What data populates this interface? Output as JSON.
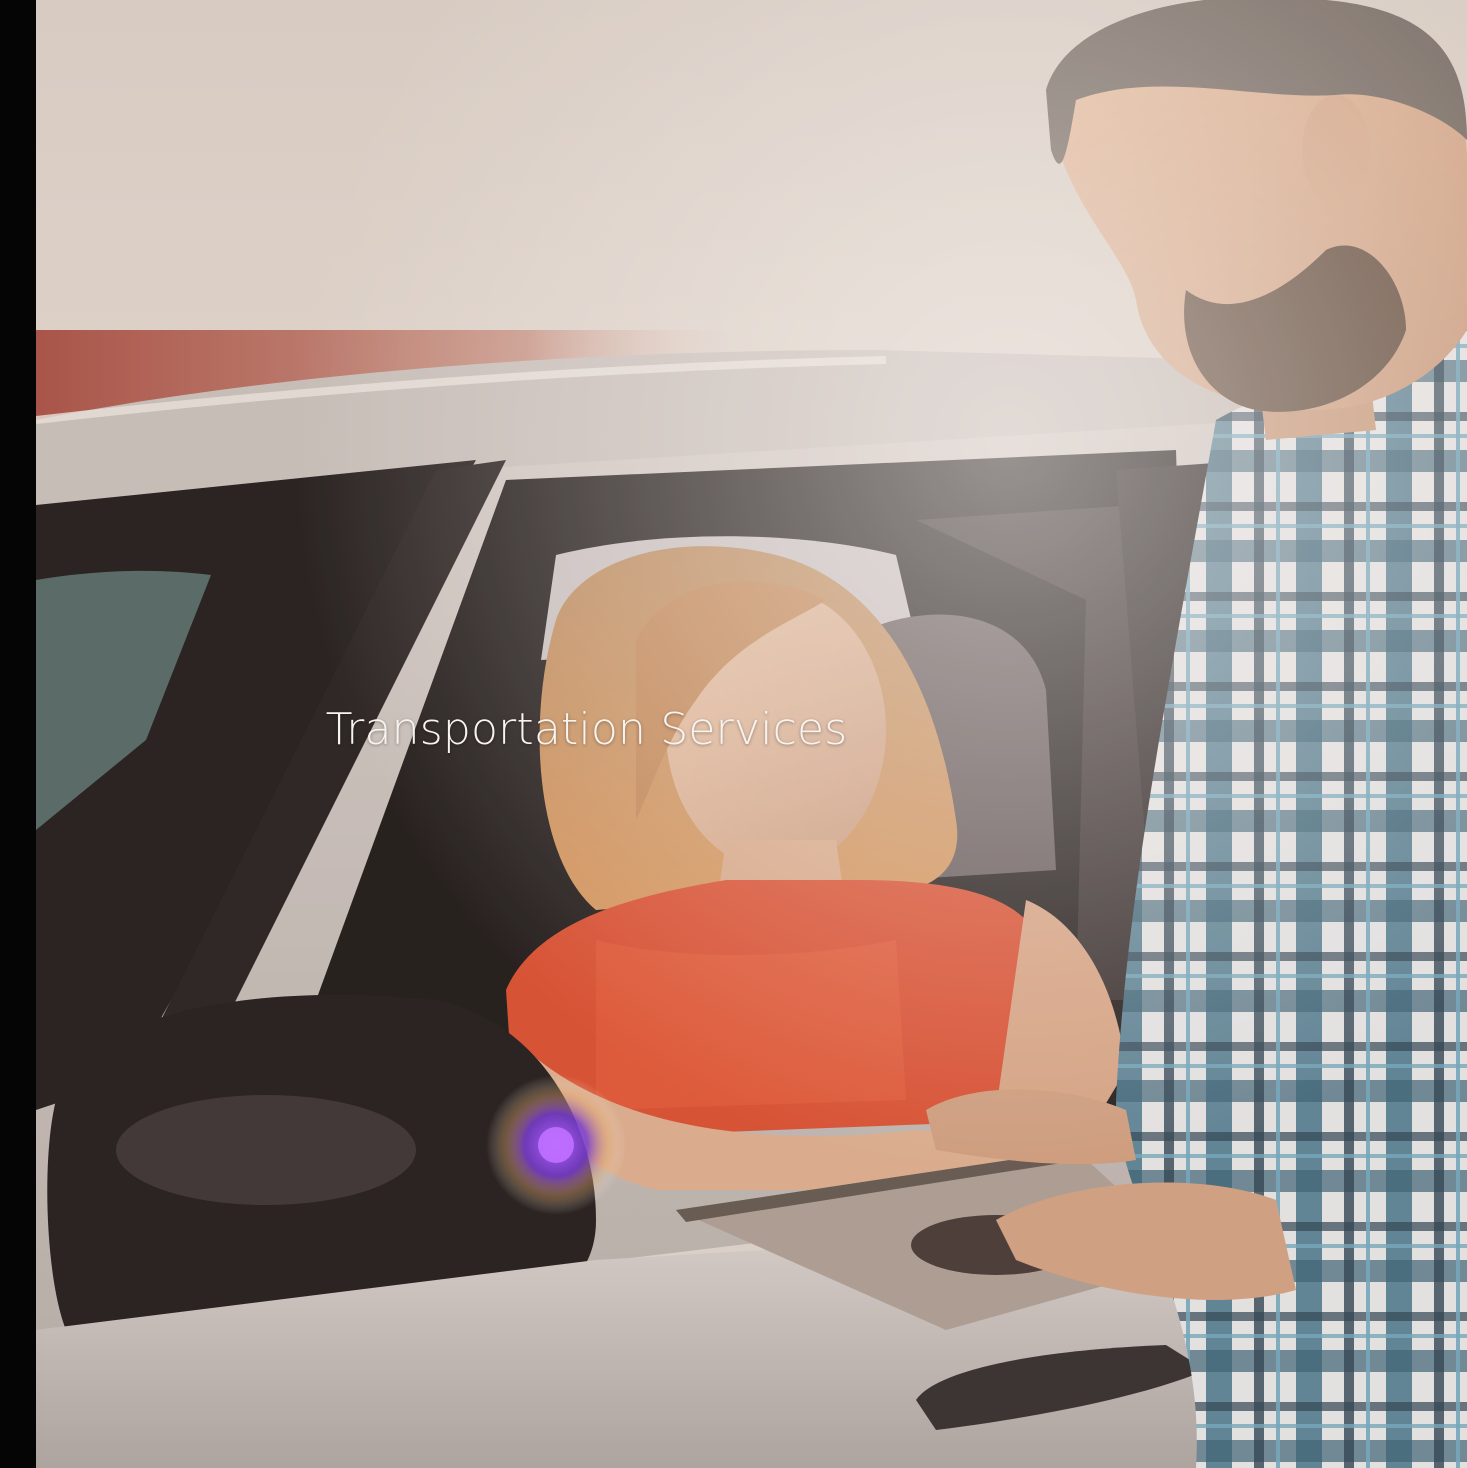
{
  "banner": {
    "title": "Transportation Services"
  },
  "photo": {
    "subject": "photo-scene",
    "palette": {
      "background": "#d4cbc4",
      "car_body": "#c9c4c2",
      "window_dark": "#141213",
      "blouse": "#e0502e",
      "hair": "#c88a55",
      "shirt_blue": "#3f7a94",
      "shirt_white": "#e8e8ea",
      "clipboard": "#a89c94",
      "lens_flare": "#a450e8"
    }
  }
}
